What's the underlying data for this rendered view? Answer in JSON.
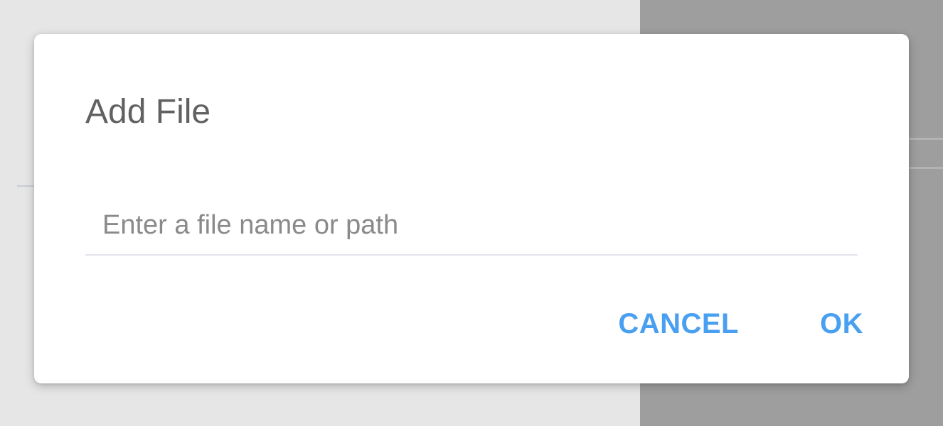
{
  "dialog": {
    "title": "Add File",
    "input": {
      "value": "",
      "placeholder": "Enter a file name or path"
    },
    "buttons": {
      "cancel_label": "CANCEL",
      "ok_label": "OK"
    }
  },
  "colors": {
    "accent": "#4aa0f0",
    "title_text": "#616161",
    "placeholder_text": "#8a8a8a",
    "dialog_background": "#ffffff",
    "backdrop_left": "#e6e6e6",
    "backdrop_right": "#9e9e9e"
  }
}
